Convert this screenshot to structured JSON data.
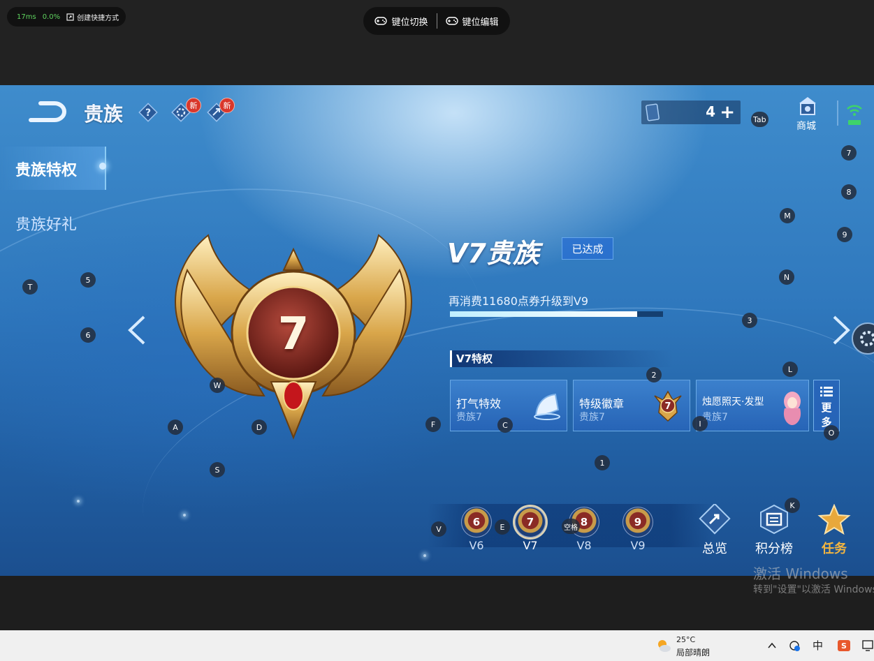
{
  "emulator": {
    "latency": "17ms",
    "cpu": "0.0%",
    "shortcut_label": "创建快捷方式",
    "keymap_switch": "键位切换",
    "keymap_edit": "键位编辑"
  },
  "header": {
    "title": "贵族",
    "help_icon": "question-icon",
    "settings_icon": "gear-icon",
    "share_icon": "share-icon",
    "new_badge": "新",
    "ticket_count": "4",
    "shop_label": "商城"
  },
  "sidebar": {
    "items": [
      {
        "label": "贵族特权",
        "active": true
      },
      {
        "label": "贵族好礼",
        "active": false
      }
    ]
  },
  "emblem": {
    "level_number": "7"
  },
  "info": {
    "level_title": "V7贵族",
    "status_tag": "已达成",
    "upgrade_text": "再消费11680点券升级到V9",
    "progress": 0.88,
    "privilege_header": "V7特权",
    "privileges": [
      {
        "name": "打气特效",
        "tier": "贵族7"
      },
      {
        "name": "特级徽章",
        "tier": "贵族7"
      },
      {
        "name": "烛愿照天·发型",
        "tier": "贵族7"
      }
    ],
    "more_label_1": "更",
    "more_label_2": "多"
  },
  "levels": [
    {
      "num": "6",
      "label": "V6"
    },
    {
      "num": "7",
      "label": "V7"
    },
    {
      "num": "8",
      "label": "V8"
    },
    {
      "num": "9",
      "label": "V9"
    }
  ],
  "bottom_buttons": {
    "overview": "总览",
    "leaderboard": "积分榜",
    "tasks": "任务"
  },
  "key_hints": {
    "tab": "Tab",
    "k7": "7",
    "k8": "8",
    "m": "M",
    "k9": "9",
    "n": "N",
    "t": "T",
    "k5": "5",
    "k6": "6",
    "k3": "3",
    "k2": "2",
    "l": "L",
    "w": "W",
    "a": "A",
    "d": "D",
    "f": "F",
    "c": "C",
    "i": "I",
    "o": "O",
    "s": "S",
    "k1": "1",
    "k": "K",
    "v": "V",
    "e": "E",
    "space": "空格"
  },
  "watermark": {
    "title": "激活 Windows",
    "subtitle": "转到\"设置\"以激活 Windows"
  },
  "taskbar": {
    "temperature": "25°C",
    "weather": "局部晴朗",
    "ime": "中"
  },
  "colors": {
    "accent": "#3f8ccc",
    "gold": "#d9a64a",
    "badge_red": "#d9372b",
    "task_gold": "#f3b540"
  }
}
